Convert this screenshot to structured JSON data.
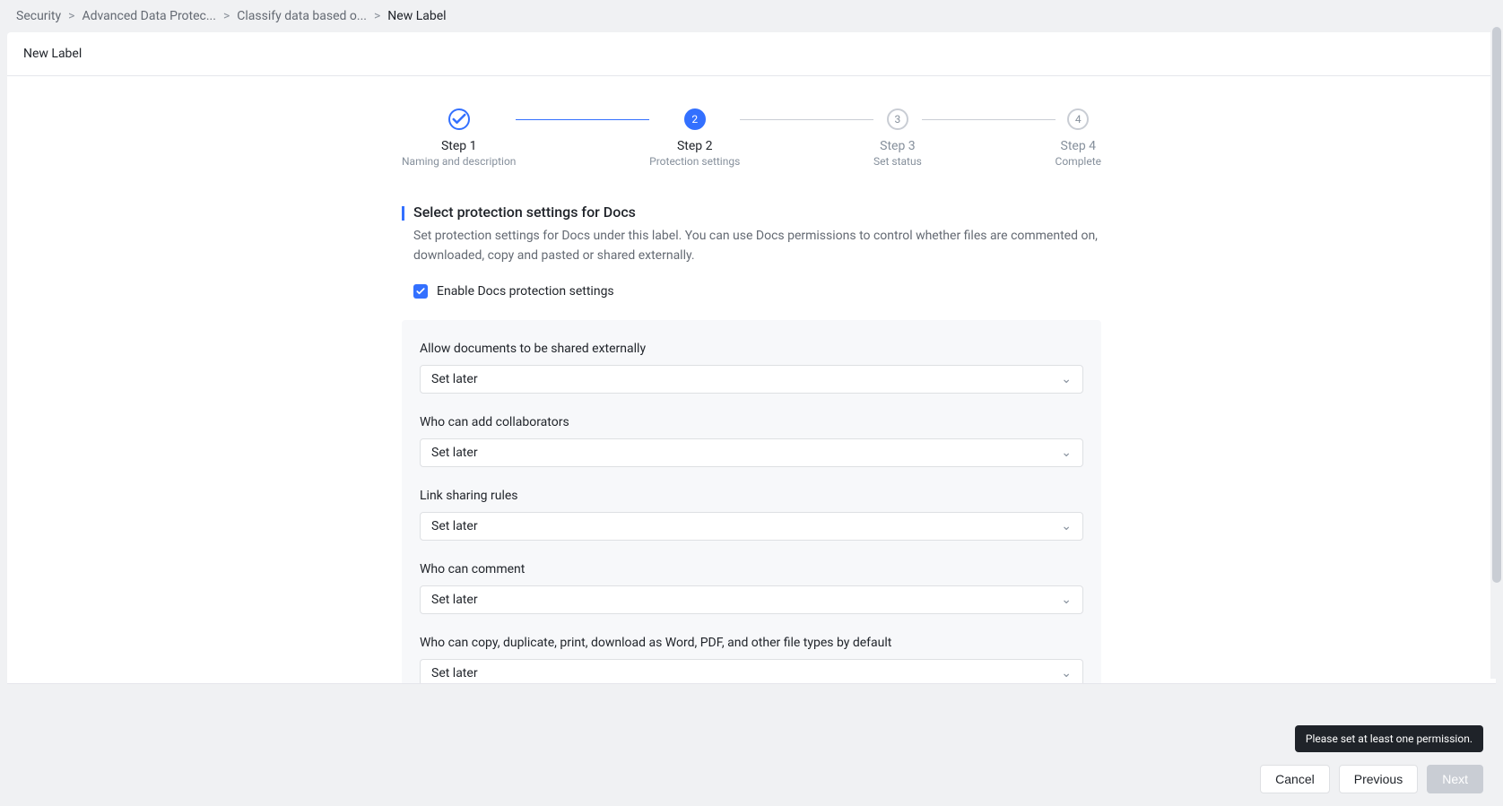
{
  "breadcrumb": {
    "items": [
      "Security",
      "Advanced Data Protec...",
      "Classify data based o...",
      "New Label"
    ]
  },
  "page_title": "New Label",
  "steps": [
    {
      "n": "1",
      "title": "Step 1",
      "desc": "Naming and description"
    },
    {
      "n": "2",
      "title": "Step 2",
      "desc": "Protection settings"
    },
    {
      "n": "3",
      "title": "Step 3",
      "desc": "Set status"
    },
    {
      "n": "4",
      "title": "Step 4",
      "desc": "Complete"
    }
  ],
  "section": {
    "title": "Select protection settings for Docs",
    "desc": "Set protection settings for Docs under this label. You can use Docs permissions to control whether files are commented on, downloaded, copy and pasted or shared externally."
  },
  "enable": {
    "label": "Enable Docs protection settings"
  },
  "fields": [
    {
      "label": "Allow documents to be shared externally",
      "value": "Set later"
    },
    {
      "label": "Who can add collaborators",
      "value": "Set later"
    },
    {
      "label": "Link sharing rules",
      "value": "Set later"
    },
    {
      "label": "Who can comment",
      "value": "Set later"
    },
    {
      "label": "Who can copy, duplicate, print, download as Word, PDF, and other file types by default",
      "value": "Set later"
    }
  ],
  "tooltip": "Please set at least one permission.",
  "buttons": {
    "cancel": "Cancel",
    "previous": "Previous",
    "next": "Next"
  }
}
